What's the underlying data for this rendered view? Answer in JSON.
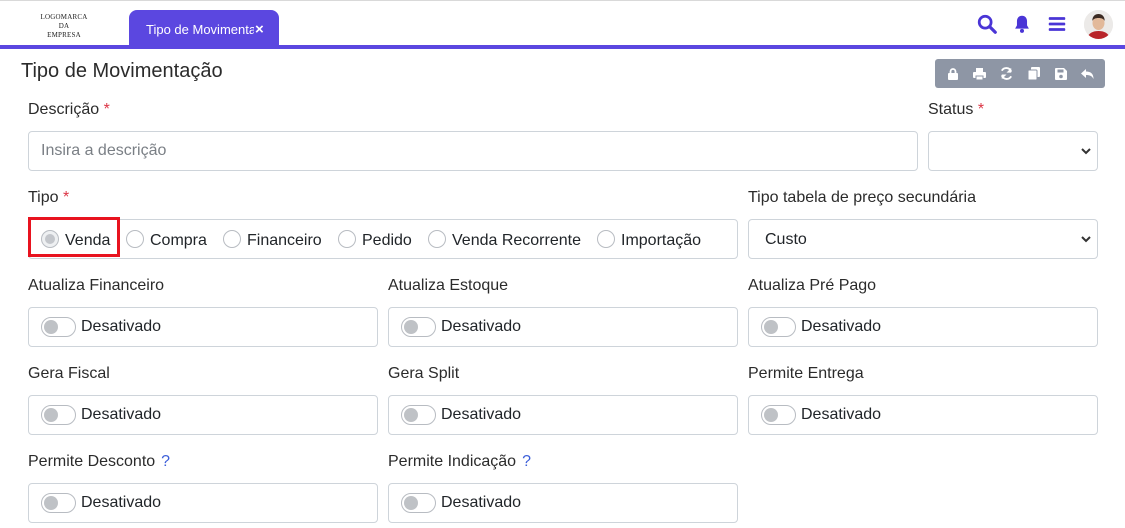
{
  "header": {
    "logo_lines": [
      "LOGOMARCA",
      "DA",
      "EMPRESA"
    ],
    "tab_label": "Tipo de Movimentação",
    "tab_close": "×",
    "accent_color": "#5b47e0",
    "icons": [
      "search-icon",
      "bell-icon",
      "menu-icon",
      "avatar"
    ]
  },
  "page": {
    "title": "Tipo de Movimentação",
    "toolbar_icons": [
      "lock-icon",
      "print-icon",
      "refresh-icon",
      "copy-icon",
      "save-icon",
      "undo-icon"
    ]
  },
  "form": {
    "required_mark": "*",
    "help_mark": "?",
    "descricao": {
      "label": "Descrição",
      "placeholder": "Insira a descrição",
      "value": ""
    },
    "status": {
      "label": "Status",
      "value": ""
    },
    "tipo": {
      "label": "Tipo",
      "options": [
        "Venda",
        "Compra",
        "Financeiro",
        "Pedido",
        "Venda Recorrente",
        "Importação"
      ],
      "selected": "Venda"
    },
    "tabela_preco": {
      "label": "Tipo tabela de preço secundária",
      "value": "Custo"
    },
    "toggles": [
      {
        "label": "Atualiza Financeiro",
        "state": "Desativado",
        "on": false
      },
      {
        "label": "Atualiza Estoque",
        "state": "Desativado",
        "on": false
      },
      {
        "label": "Atualiza Pré Pago",
        "state": "Desativado",
        "on": false
      },
      {
        "label": "Gera Fiscal",
        "state": "Desativado",
        "on": false
      },
      {
        "label": "Gera Split",
        "state": "Desativado",
        "on": false
      },
      {
        "label": "Permite Entrega",
        "state": "Desativado",
        "on": false
      },
      {
        "label": "Permite Desconto",
        "state": "Desativado",
        "on": false,
        "help": true
      },
      {
        "label": "Permite Indicação",
        "state": "Desativado",
        "on": false,
        "help": true
      }
    ]
  }
}
